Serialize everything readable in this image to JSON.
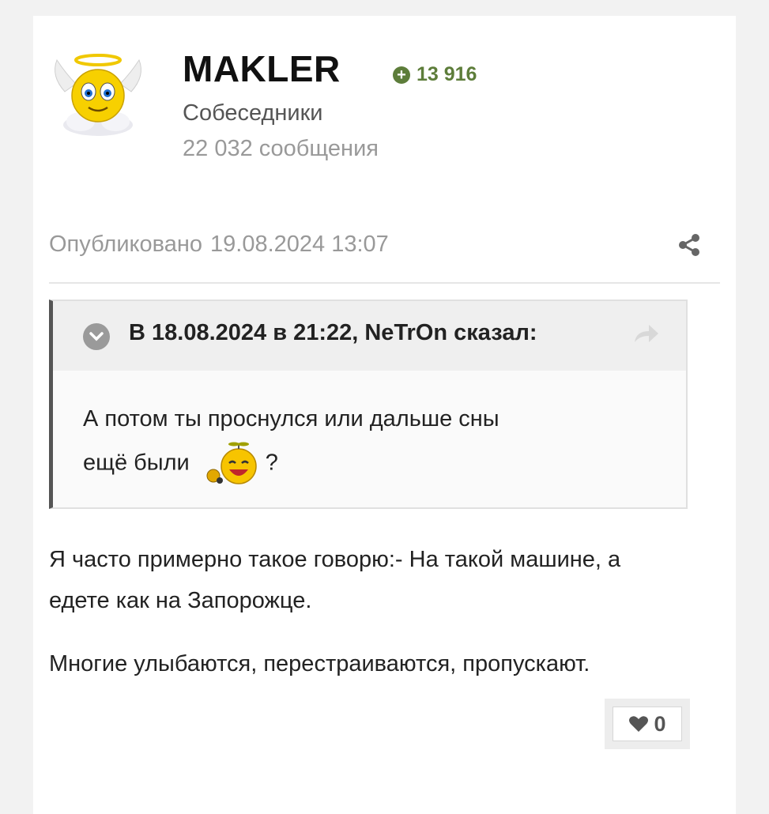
{
  "author": {
    "name": "MAKLER",
    "reputation": "13 916",
    "group": "Собеседники",
    "posts_count": "22 032",
    "posts_label": "сообщения",
    "avatar_icon": "angel-smiley-icon"
  },
  "post": {
    "published_label": "Опубликовано",
    "published_date": "19.08.2024 13:07",
    "quote": {
      "citation": "В 18.08.2024 в 21:22, NeTrOn сказал:",
      "line1": "А потом ты проснулся или дальше сны",
      "line2_before": "ещё были",
      "line2_after": "?",
      "emoji_icon": "laughing-smiley-icon"
    },
    "paragraphs": [
      "Я часто примерно такое говорю:- На такой машине, а едете как на Запорожце.",
      "Многие улыбаются, перестраиваются, пропускают."
    ],
    "likes": "0"
  },
  "colors": {
    "reputation": "#5d7d3a",
    "quote_border": "#555555"
  }
}
